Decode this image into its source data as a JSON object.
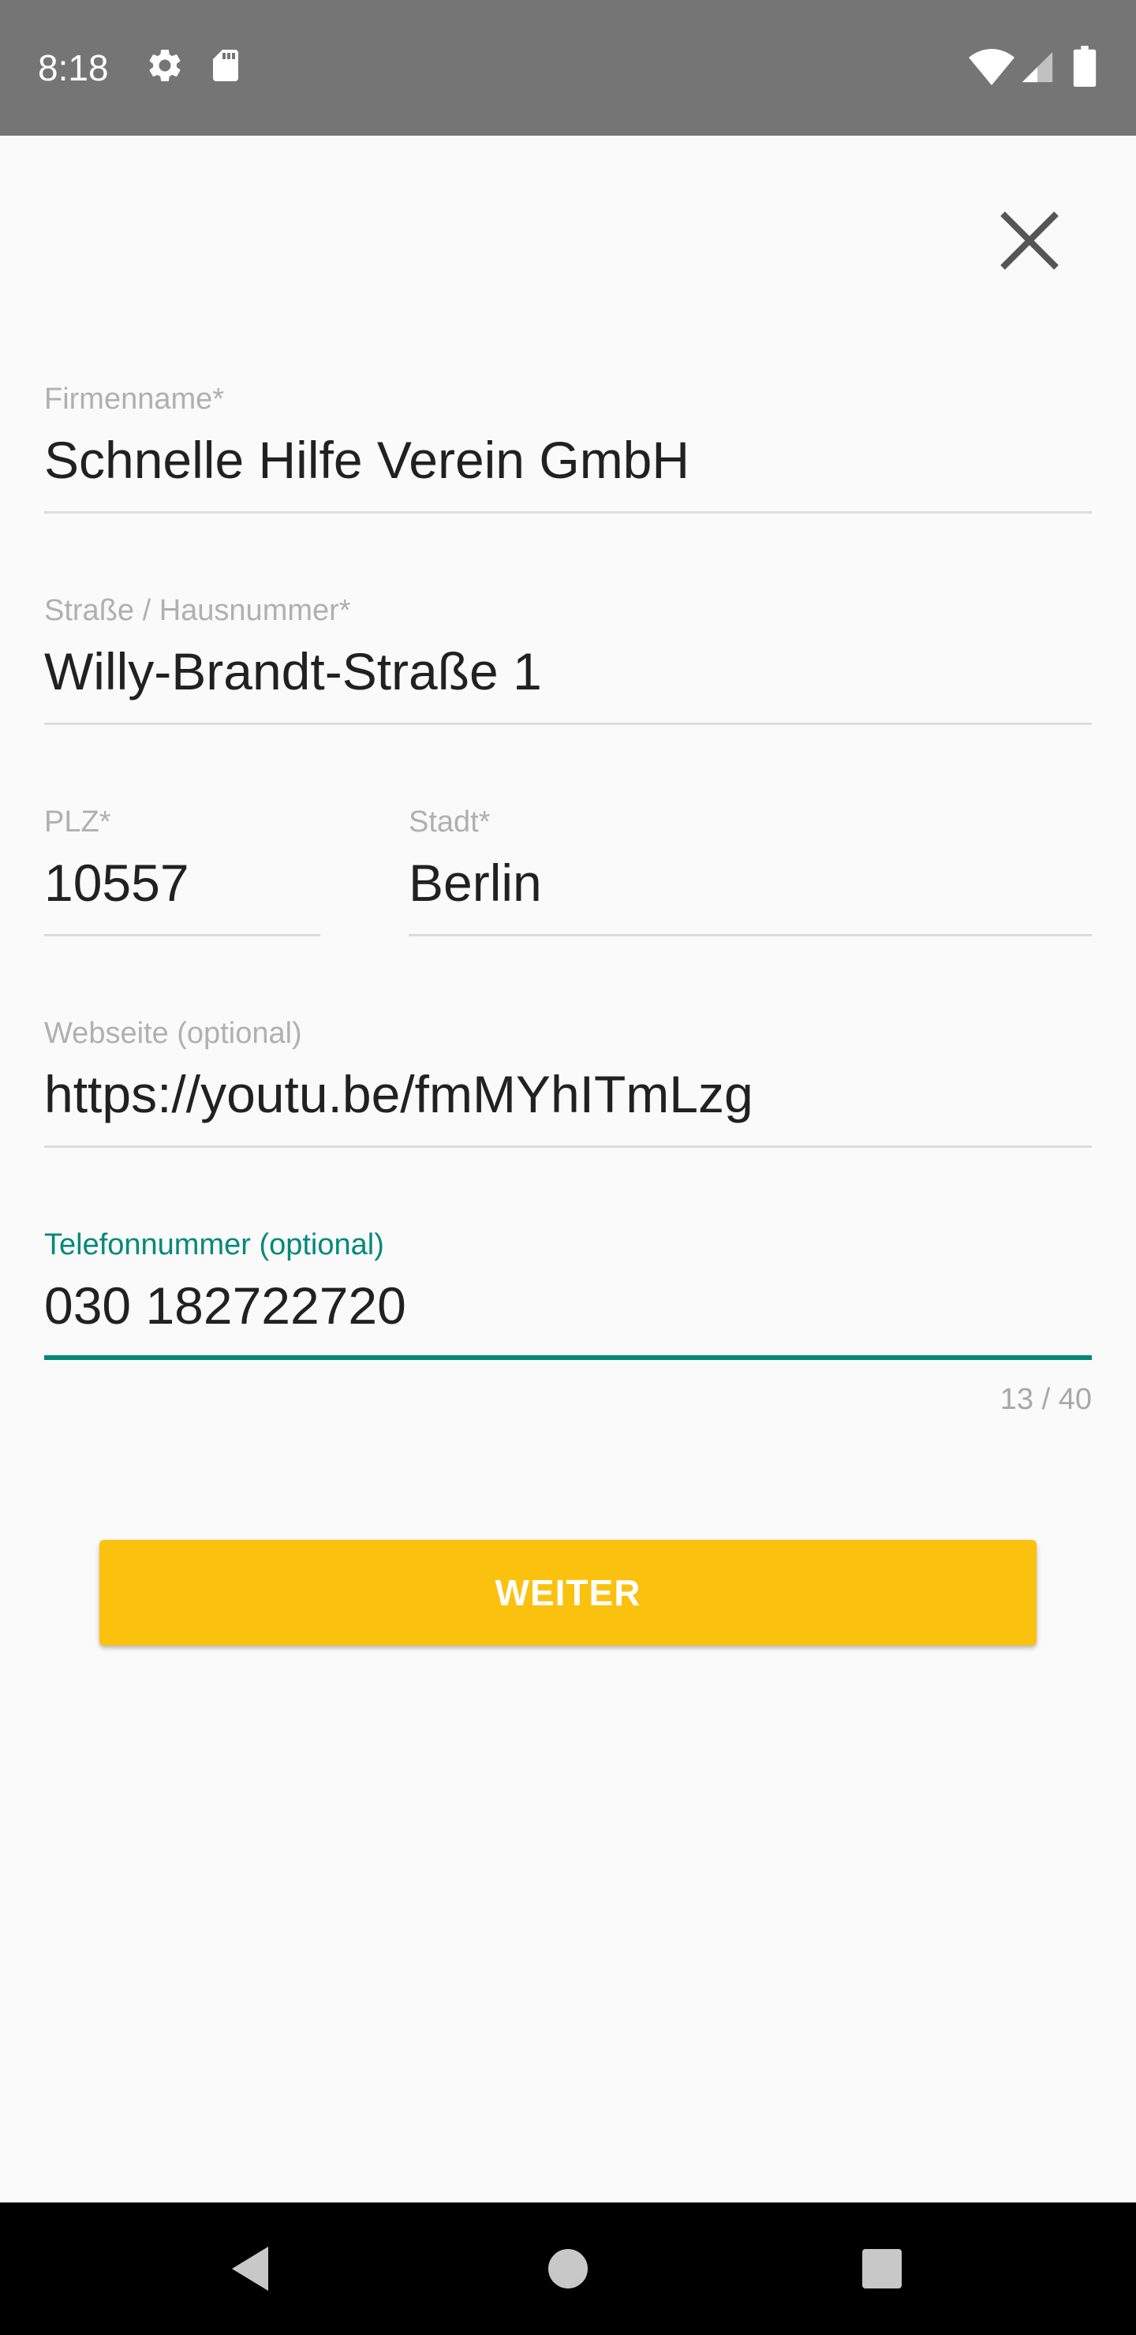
{
  "status_bar": {
    "time": "8:18",
    "icons": [
      "settings-icon",
      "sd-card-icon",
      "wifi-icon",
      "signal-icon",
      "battery-icon"
    ]
  },
  "close": {
    "icon": "close-icon"
  },
  "form": {
    "company": {
      "label": "Firmenname*",
      "value": "Schnelle Hilfe Verein GmbH"
    },
    "street": {
      "label": "Straße / Hausnummer*",
      "value": "Willy-Brandt-Straße 1"
    },
    "zip": {
      "label": "PLZ*",
      "value": "10557"
    },
    "city": {
      "label": "Stadt*",
      "value": "Berlin"
    },
    "website": {
      "label": "Webseite (optional)",
      "value": "https://youtu.be/fmMYhITmLzg"
    },
    "phone": {
      "label": "Telefonnummer (optional)",
      "value": "030 182722720",
      "counter": "13 / 40"
    }
  },
  "actions": {
    "next_label": "WEITER"
  },
  "nav_bar": {
    "icons": [
      "back-icon",
      "home-icon",
      "recents-icon"
    ]
  },
  "colors": {
    "accent": "#00897b",
    "button": "#fbc10f",
    "status_bar": "#757575"
  }
}
